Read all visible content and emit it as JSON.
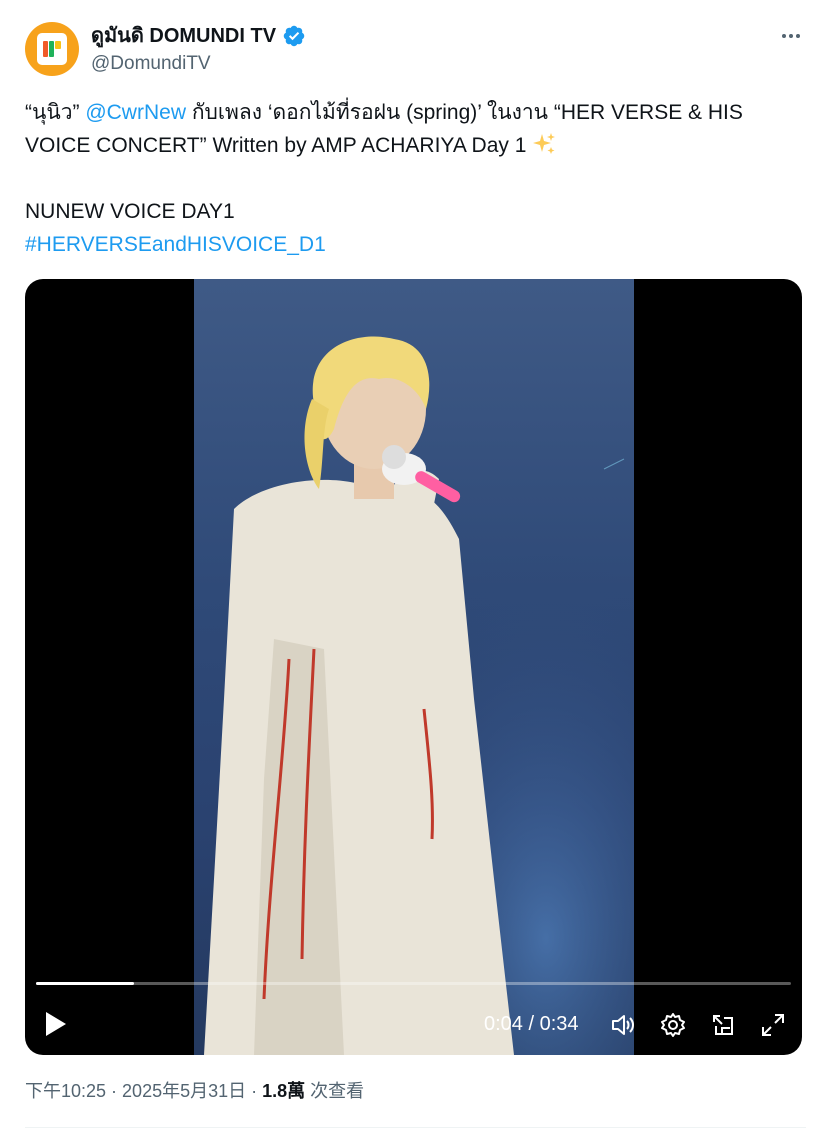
{
  "author": {
    "display_name": "ดูมันดิ DOMUNDI TV",
    "handle": "@DomundiTV",
    "verified": true,
    "avatar_colors": {
      "background": "#f7a21b"
    }
  },
  "tweet": {
    "line1_prefix": "“นุนิว” ",
    "mention": "@CwrNew",
    "line1_suffix": " กับเพลง ‘ดอกไม้ที่รอฝน (spring)’ ในงาน “HER VERSE & HIS",
    "line2": "VOICE CONCERT” Written by AMP ACHARIYA Day 1 ",
    "sparkle_emoji": "sparkles-icon",
    "line3": "NUNEW VOICE DAY1",
    "hashtag": "#HERVERSEandHISVOICE_D1"
  },
  "video": {
    "current_time": "0:04",
    "separator": " / ",
    "duration": "0:34",
    "progress": 0.13,
    "controls": [
      "play-icon",
      "volume-icon",
      "settings-icon",
      "pop-out-icon",
      "fullscreen-icon"
    ]
  },
  "meta": {
    "time": "下午10:25",
    "sep1": " · ",
    "date": "2025年5月31日",
    "sep2": " · ",
    "views_count": "1.8萬",
    "views_label": " 次查看"
  },
  "colors": {
    "link": "#1d9bf0",
    "verified": "#1d9bf0",
    "secondary_text": "#536471"
  }
}
